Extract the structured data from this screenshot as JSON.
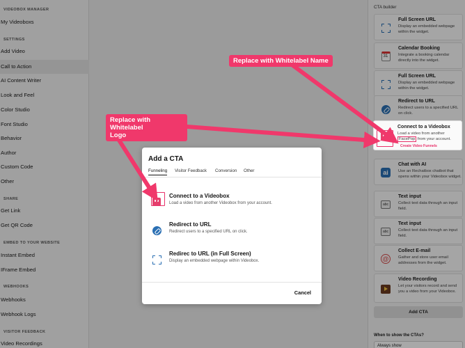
{
  "sidebar": {
    "sections": [
      {
        "title": "VIDEOBOX MANAGER",
        "items": [
          "My Videoboxs"
        ]
      },
      {
        "title": "SETTINGS",
        "items": [
          "Add Video",
          "Call to Action",
          "AI Content Writer",
          "Look and Feel",
          "Color Studio",
          "Font Studio",
          "Behavior",
          "Author",
          "Custom Code",
          "Other"
        ]
      },
      {
        "title": "SHARE",
        "items": [
          "Get Link",
          "Get QR Code"
        ]
      },
      {
        "title": "EMBED TO YOUR WEBSITE",
        "items": [
          "Instant Embed",
          "IFrame Embed"
        ]
      },
      {
        "title": "WEBHOOKS",
        "items": [
          "Webhooks",
          "Webhook Logs"
        ]
      },
      {
        "title": "VISITOR FEEDBACK",
        "items": [
          "Video Recordings"
        ]
      }
    ],
    "active_item": "Call to Action"
  },
  "cta_builder": {
    "title": "CTA builder",
    "cards": [
      {
        "title": "Full Screen URL",
        "desc": "Display an embedded webpage within the widget.",
        "icon": "frame-icon"
      },
      {
        "title": "Calendar Booking",
        "desc": "Integrate a booking calendar directly into the widget.",
        "icon": "calendar-icon",
        "icon_text": "31"
      },
      {
        "title": "Full Screen URL",
        "desc": "Display an embedded webpage within the widget.",
        "icon": "frame-icon"
      },
      {
        "title": "Redirect to URL",
        "desc": "Redirect users to a specified URL on click.",
        "icon": "link-icon"
      },
      {
        "title": "Chat with AI",
        "desc": "Use an Rechatbox chatbot that opens within your Videobox widget.",
        "icon": "chat-ai-icon",
        "icon_text": "ai"
      },
      {
        "title": "Text input",
        "desc": "Collect text data through an input field.",
        "icon": "text-input-icon",
        "icon_text": "abc"
      },
      {
        "title": "Text input",
        "desc": "Collect text data through an input field.",
        "icon": "text-input-icon",
        "icon_text": "abc"
      },
      {
        "title": "Collect E-mail",
        "desc": "Gather and store user email addresses from the widget.",
        "icon": "email-icon",
        "icon_text": "@"
      },
      {
        "title": "Video Recording",
        "desc": "Let your visitors record and send you a video from your Videobox.",
        "icon": "video-icon"
      }
    ],
    "highlighted_card": {
      "title": "Connect to a Videobox",
      "desc_line1": "Load a video from another",
      "desc_brand": "FacePop",
      "desc_line2_rest": "from your account.",
      "link": "Create Video Funnels"
    },
    "add_button": "Add CTA",
    "when_label": "When to show the CTAs?",
    "when_value": "Always show"
  },
  "modal": {
    "title": "Add a CTA",
    "tabs": [
      "Funneling",
      "Visitor Feedback",
      "Conversion",
      "Other"
    ],
    "active_tab": "Funneling",
    "options": [
      {
        "title": "Connect to a Videobox",
        "desc": "Load a video from another Videobox from your account."
      },
      {
        "title": "Redirect to URL",
        "desc": "Redirect users to a specified URL on click."
      },
      {
        "title": "Redirec to URL (in Full Screen)",
        "desc": "Display an embedded webpage within Videobox."
      }
    ],
    "cancel_label": "Cancel"
  },
  "annotations": {
    "name_callout": "Replace with Whitelabel Name",
    "logo_callout_line1": "Replace with Whitelabel",
    "logo_callout_line2": "Logo",
    "color": "#f0386b"
  }
}
